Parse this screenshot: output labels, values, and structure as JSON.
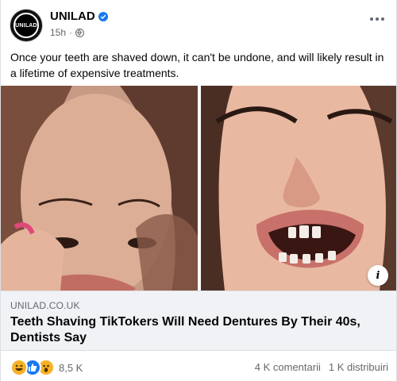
{
  "post": {
    "page_name": "UNILAD",
    "avatar_text": "UNILAD",
    "time": "15h",
    "separator": "·",
    "text": "Once your teeth are shaved down, it can't be undone, and will likely result in a lifetime of expensive treatments."
  },
  "link_preview": {
    "domain": "UNILAD.CO.UK",
    "headline": "Teeth Shaving TikTokers Will Need Dentures By Their 40s, Dentists Say",
    "info_label": "i"
  },
  "footer": {
    "reaction_count": "8,5 K",
    "comments": "4 K comentarii",
    "shares": "1 K distribuiri"
  },
  "icons": {
    "verified": "verified-badge-icon",
    "privacy": "globe-icon",
    "more": "more-options-icon",
    "reactions": [
      "haha-reaction-icon",
      "like-reaction-icon",
      "wow-reaction-icon"
    ]
  },
  "colors": {
    "accent": "#1877f2",
    "secondary_text": "#65676b",
    "link_box_bg": "#f0f2f5"
  }
}
